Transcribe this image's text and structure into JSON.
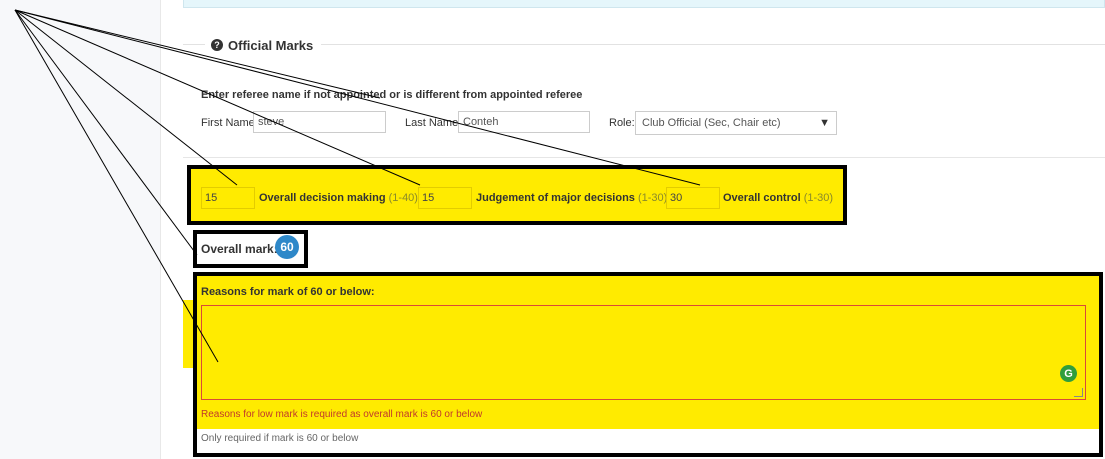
{
  "section": {
    "title": "Official Marks",
    "help_icon": "question-circle-icon"
  },
  "referee": {
    "instruction": "Enter referee name if not appointed or is different from appointed referee",
    "first_name_label": "First Name:",
    "first_name_value": "steve",
    "last_name_label": "Last Name:",
    "last_name_value": "Conteh",
    "role_label": "Role:",
    "role_value": "Club Official (Sec, Chair etc)"
  },
  "marks": [
    {
      "value": "15",
      "label": "Overall decision making",
      "range": "(1-40)"
    },
    {
      "value": "15",
      "label": "Judgement of major decisions",
      "range": "(1-30)"
    },
    {
      "value": "30",
      "label": "Overall control",
      "range": "(1-30)"
    }
  ],
  "overall": {
    "label": "Overall mark:",
    "value": "60"
  },
  "reasons": {
    "label": "Reasons for mark of 60 or below:",
    "value": "",
    "error": "Reasons for low mark is required as overall mark is 60 or below",
    "help": "Only required if mark is 60 or below",
    "grammar_icon": "grammarly-g-icon"
  },
  "colors": {
    "highlight": "#ffeb00",
    "badge": "#2e88c9",
    "error": "#c0392b"
  }
}
